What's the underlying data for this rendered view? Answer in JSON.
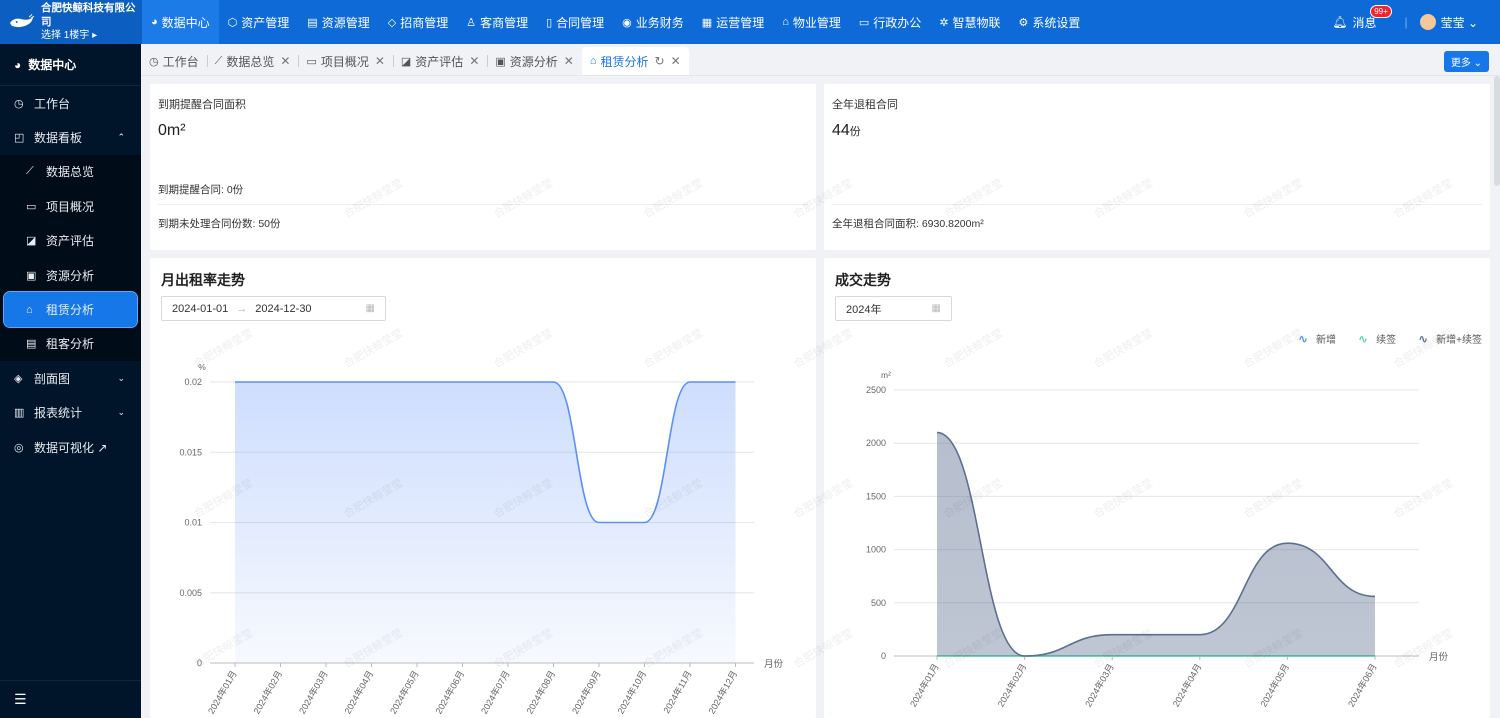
{
  "topbar": {
    "org": "合肥快鲸科技有限公司",
    "selector": "选择 1楼宇 ▸",
    "nav": [
      {
        "label": "数据中心",
        "icon": "pie-chart-icon",
        "glyph": "◕",
        "active": true
      },
      {
        "label": "资产管理",
        "icon": "cube-icon",
        "glyph": "⬡"
      },
      {
        "label": "资源管理",
        "icon": "building-icon",
        "glyph": "▤"
      },
      {
        "label": "招商管理",
        "icon": "tag-icon",
        "glyph": "◇"
      },
      {
        "label": "客商管理",
        "icon": "users-icon",
        "glyph": "♙"
      },
      {
        "label": "合同管理",
        "icon": "contract-icon",
        "glyph": "▯"
      },
      {
        "label": "业务财务",
        "icon": "finance-icon",
        "glyph": "◉"
      },
      {
        "label": "运营管理",
        "icon": "operation-icon",
        "glyph": "▦"
      },
      {
        "label": "物业管理",
        "icon": "home-icon",
        "glyph": "⌂"
      },
      {
        "label": "行政办公",
        "icon": "monitor-icon",
        "glyph": "▭"
      },
      {
        "label": "智慧物联",
        "icon": "iot-icon",
        "glyph": "✲"
      },
      {
        "label": "系统设置",
        "icon": "gear-icon",
        "glyph": "⚙"
      }
    ],
    "message_label": "消息",
    "message_badge": "99+",
    "user_name": "莹莹 ⌄"
  },
  "sidebar": {
    "header": "数据中心",
    "items": [
      {
        "label": "工作台",
        "icon": "dashboard-icon",
        "glyph": "◷",
        "level": 1
      },
      {
        "label": "数据看板",
        "icon": "chart-board-icon",
        "glyph": "◰",
        "level": 1,
        "arrow": "⌃"
      },
      {
        "label": "数据总览",
        "icon": "broom-icon",
        "glyph": "⟋",
        "level": 2
      },
      {
        "label": "项目概况",
        "icon": "monitor-icon",
        "glyph": "▭",
        "level": 2
      },
      {
        "label": "资产评估",
        "icon": "edit-icon",
        "glyph": "◪",
        "level": 2
      },
      {
        "label": "资源分析",
        "icon": "resource-icon",
        "glyph": "▣",
        "level": 2
      },
      {
        "label": "租赁分析",
        "icon": "home-icon",
        "glyph": "⌂",
        "level": 2,
        "active": true
      },
      {
        "label": "租客分析",
        "icon": "tenant-icon",
        "glyph": "▤",
        "level": 2
      },
      {
        "label": "剖面图",
        "icon": "section-icon",
        "glyph": "◈",
        "level": 1,
        "arrow": "⌄"
      },
      {
        "label": "报表统计",
        "icon": "report-icon",
        "glyph": "▥",
        "level": 1,
        "arrow": "⌄"
      },
      {
        "label": "数据可视化 ↗",
        "icon": "visual-icon",
        "glyph": "◎",
        "level": 1
      }
    ]
  },
  "tabs": [
    {
      "label": "工作台",
      "icon": "dashboard-icon",
      "glyph": "◷",
      "closable": false
    },
    {
      "label": "数据总览",
      "icon": "broom-icon",
      "glyph": "⟋",
      "closable": true
    },
    {
      "label": "项目概况",
      "icon": "monitor-icon",
      "glyph": "▭",
      "closable": true
    },
    {
      "label": "资产评估",
      "icon": "edit-icon",
      "glyph": "◪",
      "closable": true
    },
    {
      "label": "资源分析",
      "icon": "resource-icon",
      "glyph": "▣",
      "closable": true
    },
    {
      "label": "租赁分析",
      "icon": "home-icon",
      "glyph": "⌂",
      "closable": true,
      "active": true
    }
  ],
  "more_label": "更多 ⌄",
  "kpi_left": {
    "title": "到期提醒合同面积",
    "value": "0m²",
    "line1": "到期提醒合同: 0份",
    "line2": "到期未处理合同份数: 50份"
  },
  "kpi_right": {
    "title": "全年退租合同",
    "value": "44",
    "unit": "份",
    "line1": "全年退租合同面积: 6930.8200m²"
  },
  "rate_chart": {
    "title": "月出租率走势",
    "start_date": "2024-01-01",
    "end_date": "2024-12-30"
  },
  "deal_chart": {
    "title": "成交走势",
    "year": "2024年"
  },
  "watermark": "合肥快鲸莹莹",
  "chart_data": [
    {
      "type": "area",
      "ylabel": "%",
      "xlabel": "月份",
      "ylim": [
        0,
        0.02
      ],
      "yticks": [
        "0",
        "0.005",
        "0.01",
        "0.015",
        "0.02"
      ],
      "categories": [
        "2024年01月",
        "2024年02月",
        "2024年03月",
        "2024年04月",
        "2024年05月",
        "2024年06月",
        "2024年07月",
        "2024年08月",
        "2024年09月",
        "2024年10月",
        "2024年11月",
        "2024年12月"
      ],
      "values": [
        0.02,
        0.02,
        0.02,
        0.02,
        0.02,
        0.02,
        0.02,
        0.02,
        0.01,
        0.01,
        0.02,
        0.02
      ],
      "color": "#5b8ff9",
      "grid": true
    },
    {
      "type": "area",
      "ylabel": "m²",
      "xlabel": "月份",
      "ylim": [
        0,
        2500
      ],
      "yticks": [
        "0",
        "500",
        "1000",
        "1500",
        "2000",
        "2500"
      ],
      "categories": [
        "2024年01月",
        "2024年02月",
        "2024年03月",
        "2024年04月",
        "2024年05月",
        "2024年06月"
      ],
      "legend_position": "top-right",
      "series": [
        {
          "name": "新增",
          "values": [
            0,
            0,
            0,
            0,
            0,
            0
          ],
          "color": "#5b8ff9"
        },
        {
          "name": "续签",
          "values": [
            0,
            0,
            0,
            0,
            0,
            0
          ],
          "color": "#5ad8a6"
        },
        {
          "name": "新增+续签",
          "values": [
            2100,
            0,
            200,
            200,
            1060,
            560
          ],
          "color": "#5d7092"
        }
      ],
      "grid": true
    }
  ]
}
